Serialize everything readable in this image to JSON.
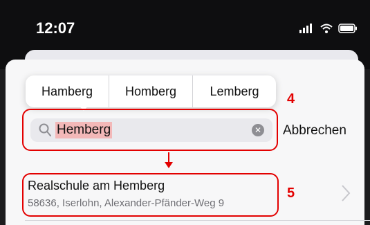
{
  "status_bar": {
    "time": "12:07"
  },
  "suggestions": [
    "Hamberg",
    "Homberg",
    "Lemberg"
  ],
  "search": {
    "query": "Hemberg",
    "cancel_label": "Abbrechen"
  },
  "annotations": {
    "step_search": "4",
    "step_result": "5",
    "highlight_color": "#e30000"
  },
  "result": {
    "title": "Realschule am Hemberg",
    "subtitle": "58636, Iserlohn, Alexander-Pfänder-Weg 9"
  },
  "icons": [
    "signal-icon",
    "wifi-icon",
    "battery-icon",
    "search-icon",
    "clear-icon",
    "chevron-right-icon"
  ]
}
